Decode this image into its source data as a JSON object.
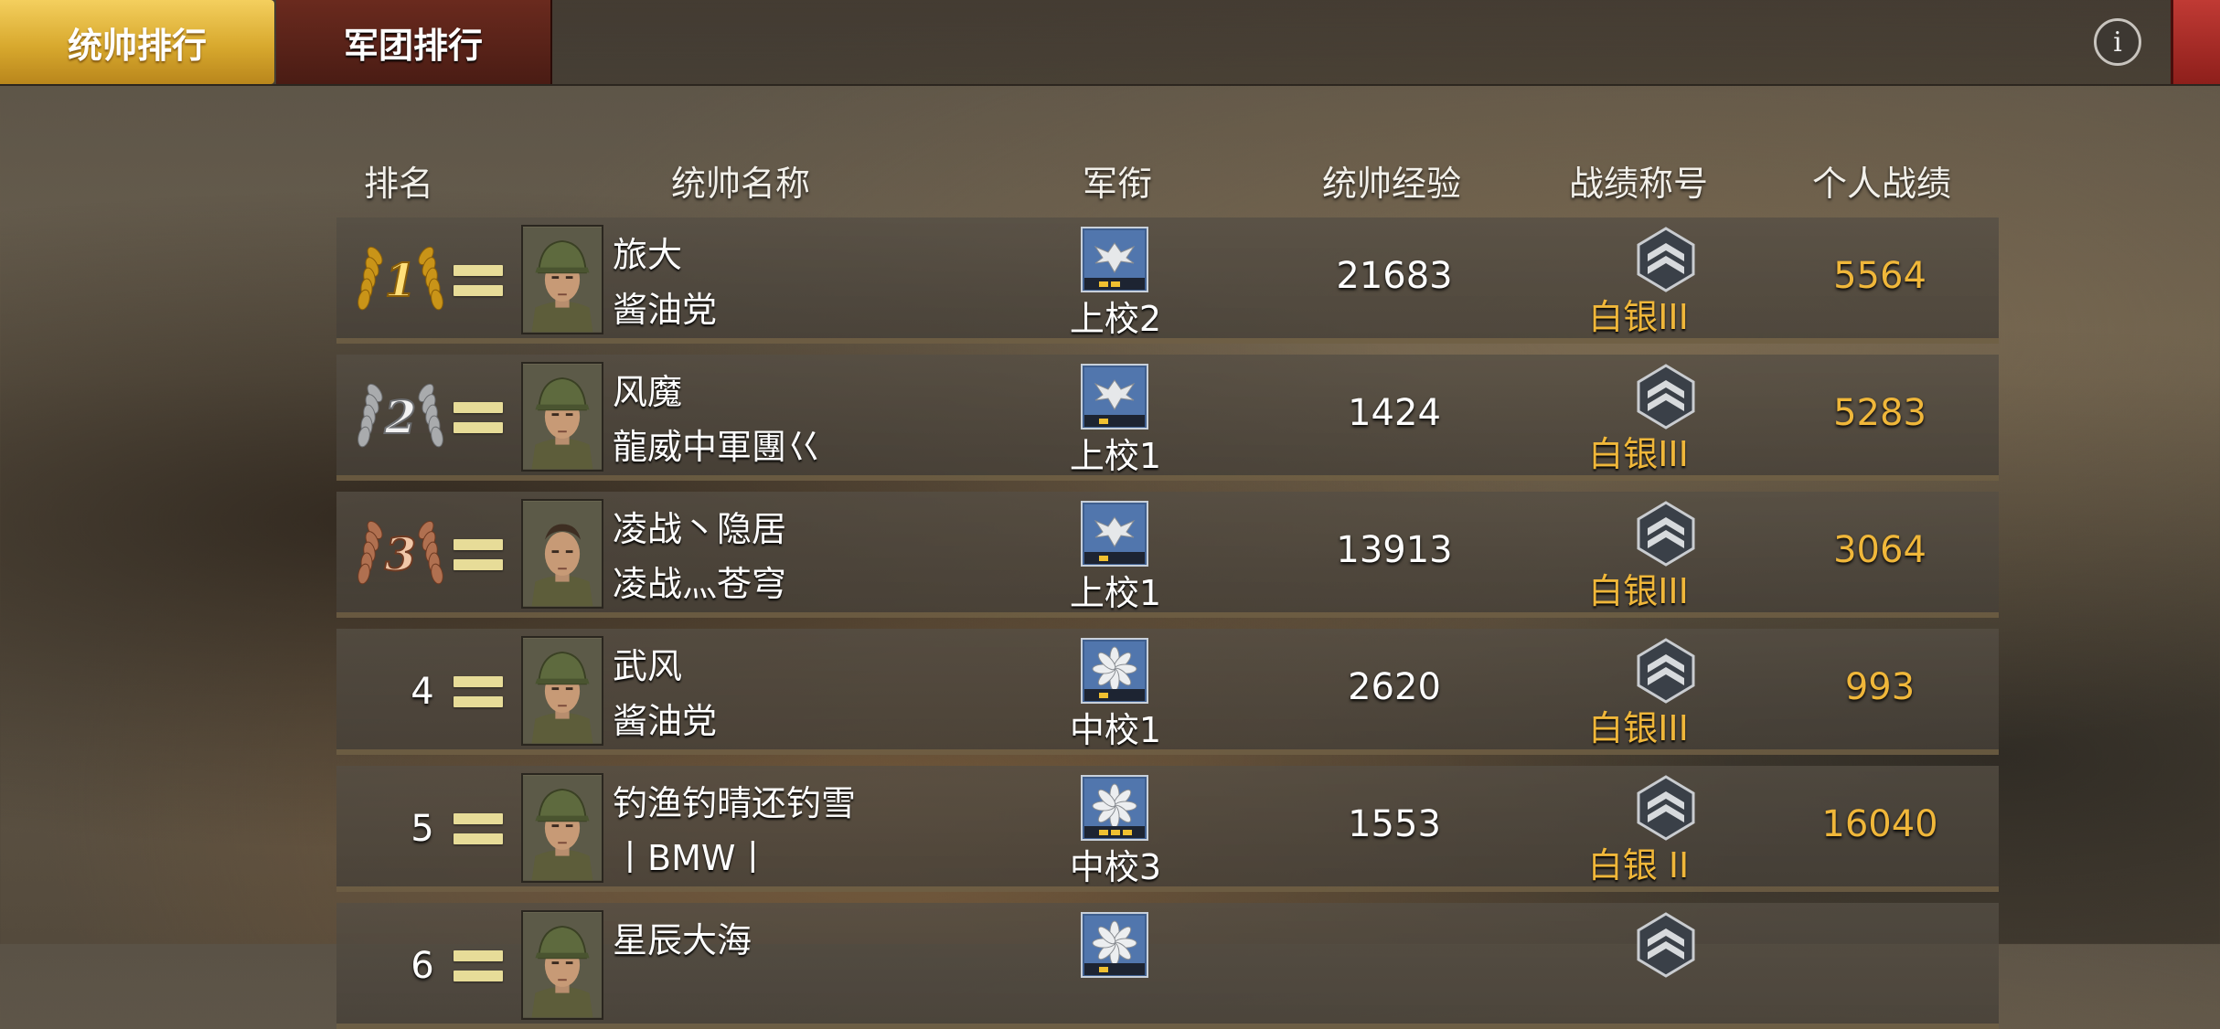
{
  "tabs": {
    "commander": "统帅排行",
    "legion": "军团排行"
  },
  "info_label": "i",
  "headers": {
    "rank": "排名",
    "name": "统帅名称",
    "military_rank": "军衔",
    "exp": "统帅经验",
    "title": "战绩称号",
    "score": "个人战绩"
  },
  "rows": [
    {
      "rank": "1",
      "medal": "gold-laurel",
      "name": "旅大",
      "guild": "酱油党",
      "rank_title": "上校2",
      "rank_icon": "eagle-insignia",
      "exp": "21683",
      "honor": "白银III",
      "score": "5564"
    },
    {
      "rank": "2",
      "medal": "silver-laurel",
      "name": "风魔",
      "guild": "龍威中軍團巜",
      "rank_title": "上校1",
      "rank_icon": "eagle-insignia",
      "exp": "1424",
      "honor": "白银III",
      "score": "5283"
    },
    {
      "rank": "3",
      "medal": "bronze-laurel",
      "name": "凌战丶隐居",
      "guild": "凌战灬苍穹",
      "rank_title": "上校1",
      "rank_icon": "eagle-insignia",
      "exp": "13913",
      "honor": "白银III",
      "score": "3064"
    },
    {
      "rank": "4",
      "medal": "",
      "name": "武风",
      "guild": "酱油党",
      "rank_title": "中校1",
      "rank_icon": "oak-leaf-insignia",
      "exp": "2620",
      "honor": "白银III",
      "score": "993"
    },
    {
      "rank": "5",
      "medal": "",
      "name": "钓渔钓晴还钓雪",
      "guild": "丨BMW丨",
      "rank_title": "中校3",
      "rank_icon": "oak-leaf-insignia",
      "exp": "1553",
      "honor": "白银 II",
      "score": "16040"
    },
    {
      "rank": "6",
      "medal": "",
      "name": "星辰大海",
      "guild": "",
      "rank_title": "",
      "rank_icon": "oak-leaf-insignia",
      "exp": "",
      "honor": "",
      "score": ""
    }
  ],
  "colors": {
    "gold_tab": "#d8a92e",
    "legion_tab": "#4a1c14",
    "score": "#f0b73a",
    "equal_mark": "#e7dc98"
  }
}
